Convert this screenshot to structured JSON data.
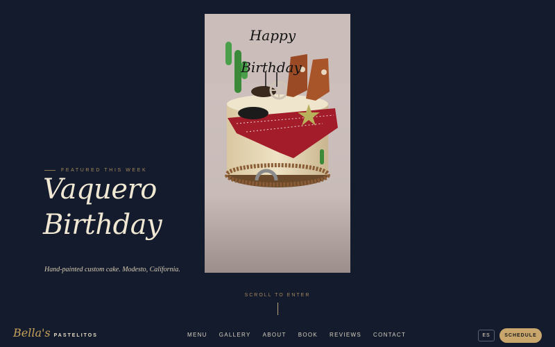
{
  "hero": {
    "eyebrow": "FEATURED THIS WEEK",
    "title_line1": "Vaquero",
    "title_line2": "Birthday",
    "subtitle": "Hand-painted custom cake. Modesto, California.",
    "photo_alt": "Cowboy themed birthday cake with boots, cactus and red bandana",
    "topper_line1": "Happy",
    "topper_line2": "Birthday"
  },
  "scroll": {
    "label": "SCROLL TO ENTER"
  },
  "brand": {
    "script": "Bella's",
    "word": "PASTELITOS"
  },
  "nav": {
    "items": [
      "MENU",
      "GALLERY",
      "ABOUT",
      "BOOK",
      "REVIEWS",
      "CONTACT"
    ]
  },
  "actions": {
    "lang_label": "ES",
    "schedule_label": "SCHEDULE"
  },
  "colors": {
    "background": "#141b2d",
    "accent": "#c9a66b",
    "cream": "#f1e8d4"
  }
}
